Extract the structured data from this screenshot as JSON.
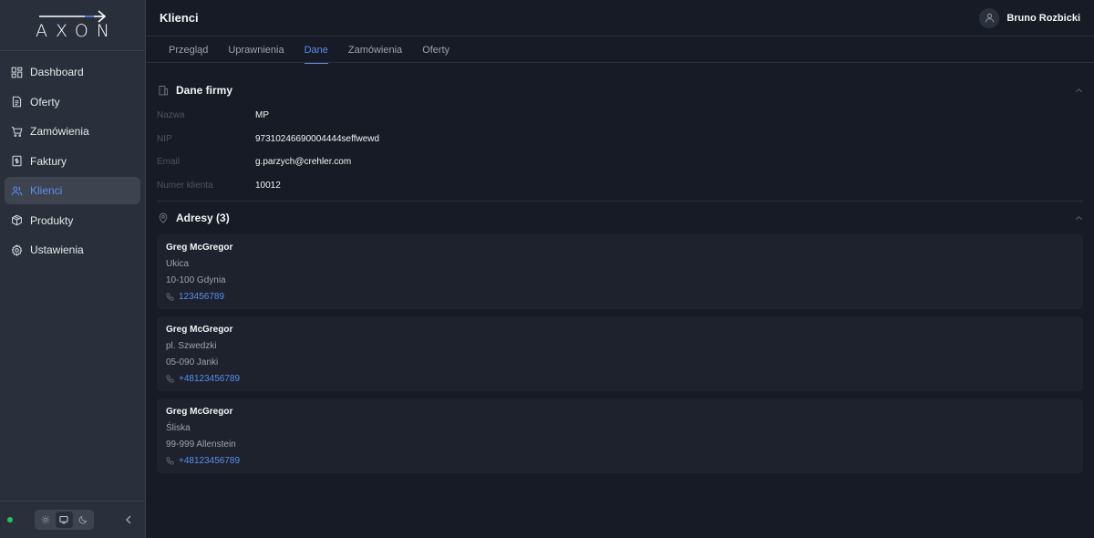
{
  "app": {
    "logo_text": "AXON"
  },
  "sidebar": {
    "items": [
      {
        "label": "Dashboard",
        "icon": "dashboard-icon"
      },
      {
        "label": "Oferty",
        "icon": "document-icon"
      },
      {
        "label": "Zamówienia",
        "icon": "cart-icon"
      },
      {
        "label": "Faktury",
        "icon": "invoice-icon"
      },
      {
        "label": "Klienci",
        "icon": "users-icon",
        "active": true
      },
      {
        "label": "Produkty",
        "icon": "box-icon"
      },
      {
        "label": "Ustawienia",
        "icon": "gear-icon"
      }
    ]
  },
  "header": {
    "title": "Klienci",
    "user_name": "Bruno Rozbicki"
  },
  "tabs": [
    {
      "label": "Przegląd"
    },
    {
      "label": "Uprawnienia"
    },
    {
      "label": "Dane",
      "active": true
    },
    {
      "label": "Zamówienia"
    },
    {
      "label": "Oferty"
    }
  ],
  "company": {
    "title": "Dane firmy",
    "fields": [
      {
        "label": "Nazwa",
        "value": "MP"
      },
      {
        "label": "NIP",
        "value": "97310246690004444seffwewd"
      },
      {
        "label": "Email",
        "value": "g.parzych@crehler.com"
      },
      {
        "label": "Numer klienta",
        "value": "10012"
      }
    ]
  },
  "addresses": {
    "title": "Adresy (3)",
    "items": [
      {
        "name": "Greg McGregor",
        "street": "Ukica",
        "city": "10-100 Gdynia",
        "phone": "123456789"
      },
      {
        "name": "Greg McGregor",
        "street": "pl. Szwedzki",
        "city": "05-090 Janki",
        "phone": "+48123456789"
      },
      {
        "name": "Greg McGregor",
        "street": "Śliska",
        "city": "99-999 Allenstein",
        "phone": "+48123456789"
      }
    ]
  },
  "colors": {
    "accent": "#5b8def",
    "status": "#22c55e",
    "bg": "#161b25",
    "sidebar": "#2a303b"
  }
}
